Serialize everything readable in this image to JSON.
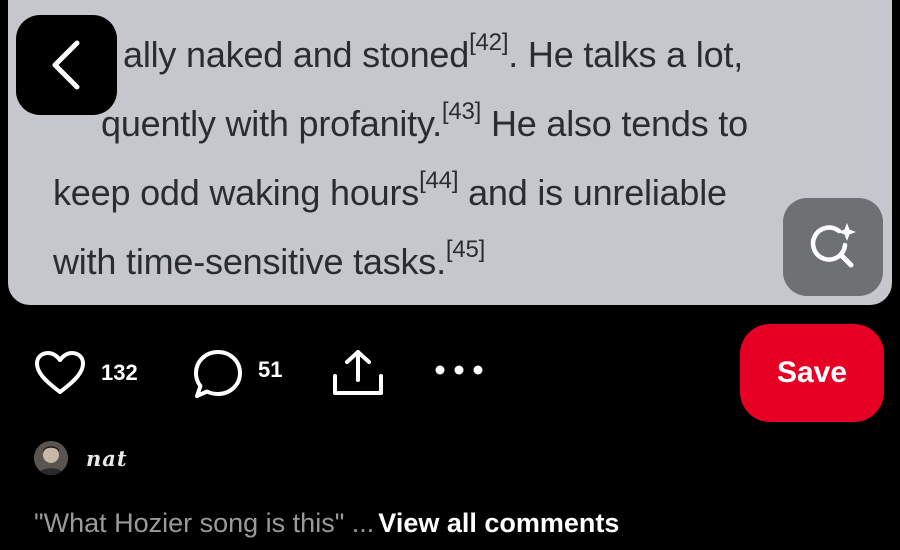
{
  "pin": {
    "lines": [
      {
        "text": "ally naked and stoned",
        "sup": "[42]",
        "after": ". He talks a lot,"
      },
      {
        "text": "quently with profanity.",
        "sup": "[43]",
        "after": " He also tends to"
      },
      {
        "text": "keep odd waking hours",
        "sup": "[44]",
        "after": " and is unreliable"
      },
      {
        "text": "with time-sensitive tasks.",
        "sup": "[45]",
        "after": ""
      }
    ]
  },
  "actions": {
    "like_count": "132",
    "comment_count": "51",
    "save_label": "Save"
  },
  "user": {
    "name": "nat"
  },
  "comments": {
    "preview": "\"What Hozier song is this\" ...",
    "view_all_label": "View all comments"
  },
  "colors": {
    "background": "#000000",
    "image_background": "#c6c7cc",
    "save_button": "#e60023",
    "comment_preview": "#9a9a9a"
  },
  "icons": [
    "back-chevron-icon",
    "visual-search-icon",
    "heart-icon",
    "comment-bubble-icon",
    "share-icon",
    "more-options-icon"
  ]
}
